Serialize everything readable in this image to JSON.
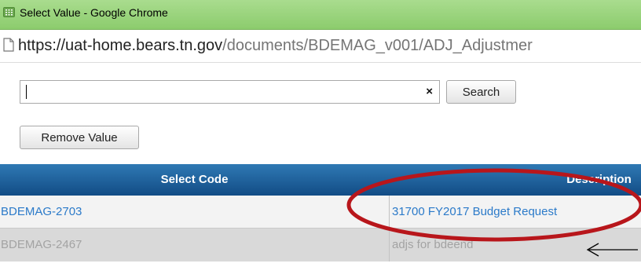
{
  "window": {
    "title": "Select Value - Google Chrome",
    "url_host": "https://uat-home.bears.tn.gov",
    "url_path": "/documents/BDEMAG_v001/ADJ_Adjustmer"
  },
  "search": {
    "value": "",
    "clear_glyph": "×",
    "button_label": "Search"
  },
  "remove_button_label": "Remove Value",
  "table": {
    "columns": [
      "Select Code",
      "Description"
    ],
    "rows": [
      {
        "code": "BDEMAG-2703",
        "description": "31700 FY2017 Budget Request"
      },
      {
        "code": "BDEMAG-2467",
        "description": "adjs for bdeend"
      }
    ]
  },
  "colors": {
    "titlebar": "#98d37b",
    "header": "#1d5f9c",
    "link": "#2b7ac9",
    "annotation_ellipse": "#b8161b"
  },
  "annotations": {
    "ellipse": "red-ellipse-around-description",
    "arrow": "left-arrow-pointing-at-row-2"
  }
}
